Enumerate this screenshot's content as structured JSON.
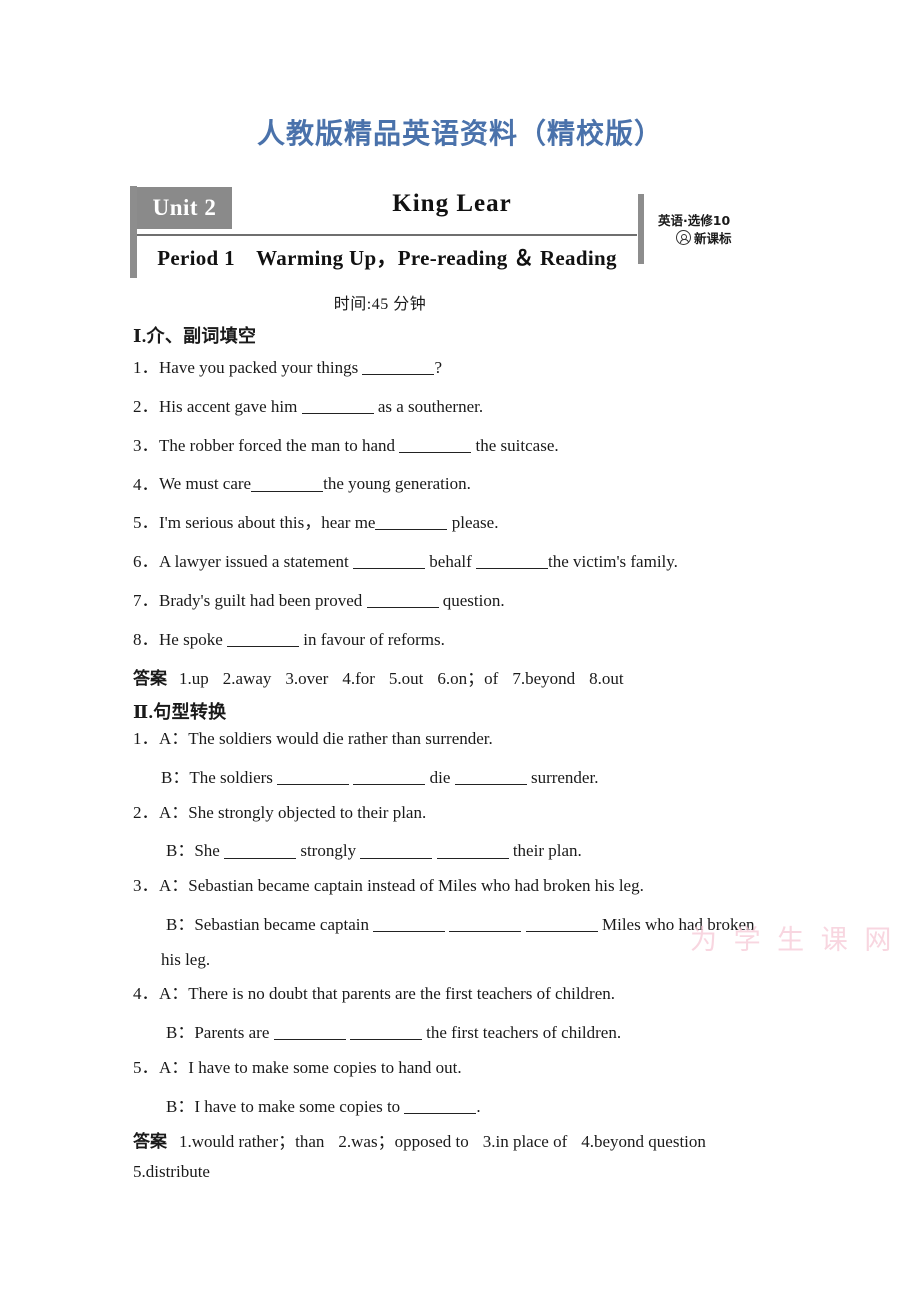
{
  "banner": {
    "text": "人教版精品英语资料（精校版）"
  },
  "header": {
    "unit_label": "Unit 2",
    "unit_title": "King Lear",
    "period": "Period 1　Warming Up，Pre-reading ＆ Reading",
    "badge_line1": "英语·选修10",
    "badge_line2": "新课标",
    "badge_icon": "person-circle-icon",
    "time_note": "时间:45 分钟"
  },
  "sections": [
    {
      "heading": "Ⅰ.介、副词填空",
      "questions": [
        {
          "num": "1．",
          "before": "Have you packed your things ",
          "after": "?"
        },
        {
          "num": "2．",
          "before": "His accent gave him ",
          "after": " as a southerner."
        },
        {
          "num": "3．",
          "before": "The robber forced the man to hand ",
          "after": " the suitcase."
        },
        {
          "num": "4．",
          "before": "We must care",
          "after": "the young generation."
        },
        {
          "num": "5．",
          "before": "I'm serious about this，hear me",
          "after": " please."
        },
        {
          "num": "6．",
          "before": "A lawyer issued a statement ",
          "mid": " behalf ",
          "after": "the victim's family."
        },
        {
          "num": "7．",
          "before": "Brady's guilt had been proved ",
          "after": " question."
        },
        {
          "num": "8．",
          "before": "He spoke ",
          "after": " in favour of reforms."
        }
      ],
      "answer_label": "答案",
      "answers": [
        "1.up",
        "2.away",
        "3.over",
        "4.for",
        "5.out",
        "6.on；of",
        "7.beyond",
        "8.out"
      ]
    }
  ],
  "section2": {
    "heading": "Ⅱ.句型转换",
    "items": [
      {
        "num": "1．",
        "a_label": "A：",
        "a_text": "The soldiers would die rather than surrender.",
        "b_label": "B：",
        "b_p1": "The soldiers ",
        "b_p2": " ",
        "b_p3": " die ",
        "b_p4": " surrender."
      },
      {
        "num": "2．",
        "a_label": "A：",
        "a_text": "She strongly objected to their plan.",
        "b_label": "B：",
        "b_p1": "She ",
        "b_p2": " strongly ",
        "b_p3": " ",
        "b_p4": " their plan."
      },
      {
        "num": "3．",
        "a_label": "A：",
        "a_text": "Sebastian became captain instead of Miles who had broken his leg.",
        "b_label": "B：",
        "b_p1": "Sebastian became captain ",
        "b_p2": " ",
        "b_p3": " ",
        "b_p4": " Miles who had broken",
        "b_wrap": "his leg."
      },
      {
        "num": "4．",
        "a_label": "A：",
        "a_text": "There is no doubt that parents are the first teachers of children.",
        "b_label": "B：",
        "b_p1": "Parents are ",
        "b_p2": " ",
        "b_p3": " the first teachers of children."
      },
      {
        "num": "5．",
        "a_label": "A：",
        "a_text": "I have to make some copies to hand out.",
        "b_label": "B：",
        "b_p1": "I have to make some copies to ",
        "b_p2": "."
      }
    ],
    "answer_label": "答案",
    "answers": [
      "1.would rather；than",
      "2.was；opposed to",
      "3.in place of",
      "4.beyond question"
    ],
    "answers_cont": "5.distribute"
  },
  "watermark": {
    "text": "为 学 生 课 网"
  },
  "colors": {
    "banner_blue": "#4a72ab",
    "unit_box_gray": "#8a8a8a",
    "rule_gray": "#6f6f6f",
    "watermark_pink": "#f6c9d6"
  }
}
